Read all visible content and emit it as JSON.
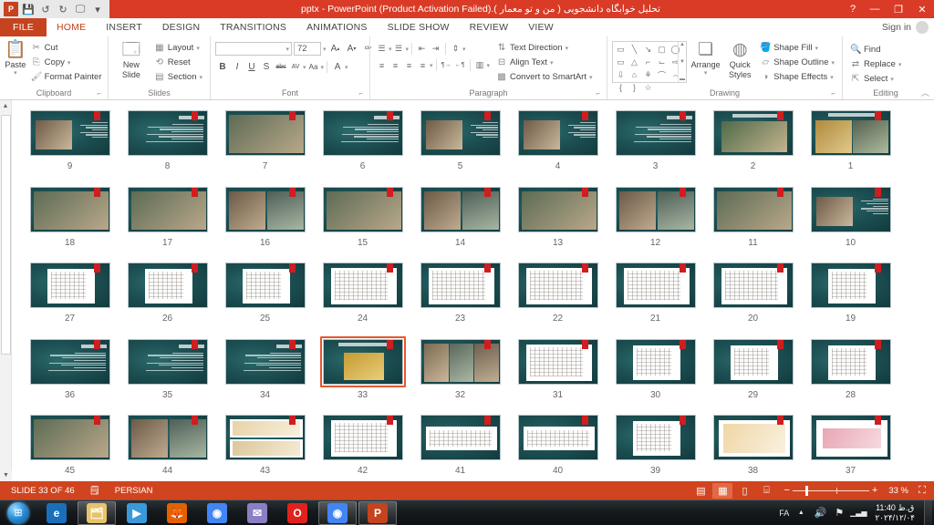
{
  "titlebar": {
    "title": "تحلیل خوابگاه دانشجویی ( من و تو معمار ).pptx  -  PowerPoint (Product Activation Failed)",
    "app_logo": "P",
    "quick_access": [
      {
        "name": "save-icon",
        "glyph": "💾"
      },
      {
        "name": "undo-icon",
        "glyph": "↺"
      },
      {
        "name": "redo-icon",
        "glyph": "↻"
      },
      {
        "name": "start-slideshow-icon",
        "glyph": "🖵"
      },
      {
        "name": "customize-qat-icon",
        "glyph": "▾"
      }
    ],
    "help": "?",
    "minimize": "—",
    "maximize": "❐",
    "close": "✕"
  },
  "tabs": [
    {
      "label": "FILE",
      "active": false
    },
    {
      "label": "HOME",
      "active": true
    },
    {
      "label": "INSERT",
      "active": false
    },
    {
      "label": "DESIGN",
      "active": false
    },
    {
      "label": "TRANSITIONS",
      "active": false
    },
    {
      "label": "ANIMATIONS",
      "active": false
    },
    {
      "label": "SLIDE SHOW",
      "active": false
    },
    {
      "label": "REVIEW",
      "active": false
    },
    {
      "label": "VIEW",
      "active": false
    }
  ],
  "signin": {
    "label": "Sign in"
  },
  "ribbon": {
    "clipboard": {
      "title": "Clipboard",
      "paste": "Paste",
      "cut": "Cut",
      "copy": "Copy",
      "format_painter": "Format Painter"
    },
    "slides": {
      "title": "Slides",
      "new_slide": "New\nSlide",
      "new_slide_l1": "New",
      "new_slide_l2": "Slide",
      "layout": "Layout",
      "reset": "Reset",
      "section": "Section"
    },
    "font": {
      "title": "Font",
      "font_name": "",
      "font_name_placeholder": "",
      "font_size": "72",
      "grow": "A",
      "shrink": "A",
      "clear_formatting": "✑",
      "bold": "B",
      "italic": "I",
      "underline": "U",
      "shadow": "S",
      "strikethrough": "abc",
      "char_spacing": "AV",
      "change_case": "Aa",
      "font_color": "A"
    },
    "paragraph": {
      "title": "Paragraph",
      "bullets": "☰",
      "numbering": "☰",
      "dec_indent": "⇤",
      "inc_indent": "⇥",
      "line_spacing": "⇕",
      "align_left": "≡",
      "align_center": "≡",
      "align_right": "≡",
      "justify": "≡",
      "columns": "▥",
      "rtl": "¶→",
      "ltr": "←¶",
      "text_direction": "Text Direction",
      "align_text": "Align Text",
      "convert_smartart": "Convert to SmartArt"
    },
    "drawing": {
      "title": "Drawing",
      "arrange": "Arrange",
      "quick_styles_l1": "Quick",
      "quick_styles_l2": "Styles",
      "shape_fill": "Shape Fill",
      "shape_outline": "Shape Outline",
      "shape_effects": "Shape Effects",
      "shapes": [
        "▭",
        "╲",
        "↘",
        "▢",
        "◯",
        "▭",
        "△",
        "⌐",
        "⌙",
        "⇨",
        "⇩",
        "⌂",
        "⚘",
        "⌒",
        "⌢",
        "{",
        "}",
        "☆"
      ]
    },
    "editing": {
      "title": "Editing",
      "find": "Find",
      "replace": "Replace",
      "select": "Select",
      "collapse_ribbon": "︿"
    }
  },
  "sorter": {
    "rows": [
      [
        {
          "num": "9",
          "kind": "photo-left-text-right"
        },
        {
          "num": "8",
          "kind": "text-only"
        },
        {
          "num": "7",
          "kind": "photo-full"
        },
        {
          "num": "6",
          "kind": "text-only"
        },
        {
          "num": "5",
          "kind": "photo-left-text-right"
        },
        {
          "num": "4",
          "kind": "photo-left-text-right"
        },
        {
          "num": "3",
          "kind": "text-only"
        },
        {
          "num": "2",
          "kind": "photo-title"
        },
        {
          "num": "1",
          "kind": "photo-two-title"
        }
      ],
      [
        {
          "num": "18",
          "kind": "photo-full"
        },
        {
          "num": "17",
          "kind": "photo-full"
        },
        {
          "num": "16",
          "kind": "photo-two"
        },
        {
          "num": "15",
          "kind": "photo-full"
        },
        {
          "num": "14",
          "kind": "photo-two"
        },
        {
          "num": "13",
          "kind": "photo-full"
        },
        {
          "num": "12",
          "kind": "photo-two"
        },
        {
          "num": "11",
          "kind": "photo-full"
        },
        {
          "num": "10",
          "kind": "photo-left-text-right"
        }
      ],
      [
        {
          "num": "27",
          "kind": "plan-white"
        },
        {
          "num": "26",
          "kind": "plan-white"
        },
        {
          "num": "25",
          "kind": "plan-white"
        },
        {
          "num": "24",
          "kind": "plan-white-wide"
        },
        {
          "num": "23",
          "kind": "plan-white-wide"
        },
        {
          "num": "22",
          "kind": "plan-white-wide"
        },
        {
          "num": "21",
          "kind": "plan-white-wide"
        },
        {
          "num": "20",
          "kind": "plan-white-wide"
        },
        {
          "num": "19",
          "kind": "plan-white"
        }
      ],
      [
        {
          "num": "36",
          "kind": "text-only"
        },
        {
          "num": "35",
          "kind": "text-only"
        },
        {
          "num": "34",
          "kind": "text-only"
        },
        {
          "num": "33",
          "kind": "selected-building",
          "selected": true,
          "caption": "خوابگاه دانشجویی کتابخانه"
        },
        {
          "num": "32",
          "kind": "photo-three"
        },
        {
          "num": "31",
          "kind": "plan-white-wide"
        },
        {
          "num": "30",
          "kind": "plan-white"
        },
        {
          "num": "29",
          "kind": "plan-white"
        },
        {
          "num": "28",
          "kind": "plan-white"
        }
      ],
      [
        {
          "num": "45",
          "kind": "photo-full"
        },
        {
          "num": "44",
          "kind": "photo-two"
        },
        {
          "num": "43",
          "kind": "section-drawings"
        },
        {
          "num": "42",
          "kind": "plan-white-wide"
        },
        {
          "num": "41",
          "kind": "section-white"
        },
        {
          "num": "40",
          "kind": "section-white"
        },
        {
          "num": "39",
          "kind": "plan-white"
        },
        {
          "num": "38",
          "kind": "sketch-orange"
        },
        {
          "num": "37",
          "kind": "site-pink"
        }
      ]
    ],
    "scrollbar": {
      "up": "▲",
      "down": "▼"
    }
  },
  "statusbar": {
    "slide_indicator": "SLIDE 33 OF 46",
    "notes_icon": "🗒",
    "language": "PERSIAN",
    "views": [
      {
        "name": "normal-view-button",
        "glyph": "▤"
      },
      {
        "name": "slide-sorter-view-button",
        "glyph": "▦",
        "selected": true
      },
      {
        "name": "reading-view-button",
        "glyph": "▯"
      },
      {
        "name": "slideshow-view-button",
        "glyph": "⌸"
      }
    ],
    "zoom_out": "−",
    "zoom_in": "+",
    "zoom_level": "33 %",
    "fit_to_window": "⛶"
  },
  "taskbar": {
    "start": "⊞",
    "apps": [
      {
        "name": "internet-explorer-icon",
        "glyph": "e",
        "color": "#1b6fba",
        "running": false
      },
      {
        "name": "file-explorer-icon",
        "glyph": "🗂",
        "color": "#e8c36a",
        "running": true
      },
      {
        "name": "media-player-icon",
        "glyph": "▶",
        "color": "#3a9ad9",
        "running": false
      },
      {
        "name": "firefox-icon",
        "glyph": "🦊",
        "color": "#e66000",
        "running": false
      },
      {
        "name": "chrome-icon",
        "glyph": "◉",
        "color": "#4285f4",
        "running": false
      },
      {
        "name": "mail-icon",
        "glyph": "✉",
        "color": "#8b7fc4",
        "running": false
      },
      {
        "name": "opera-icon",
        "glyph": "O",
        "color": "#e2211c",
        "running": false
      },
      {
        "name": "chrome-window-icon",
        "glyph": "◉",
        "color": "#4285f4",
        "running": true
      },
      {
        "name": "powerpoint-window-icon",
        "glyph": "P",
        "color": "#c5431f",
        "running": true
      }
    ],
    "tray": {
      "language": "FA",
      "show_hidden": "▲",
      "volume": "🔊",
      "action_center": "⚑",
      "network": "▁▃▅",
      "time": "11:40 ق.ظ",
      "date": "۲۰۲۴/۱۲/۰۴"
    }
  }
}
